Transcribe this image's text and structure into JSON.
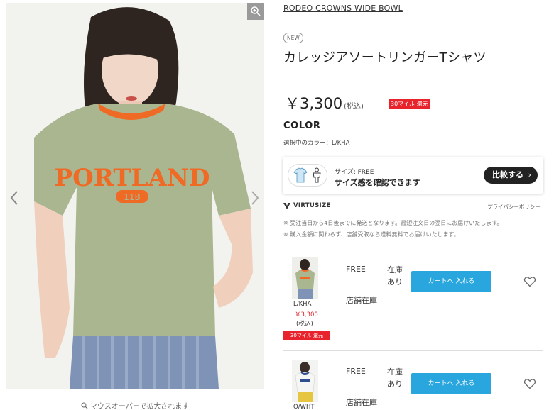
{
  "product": {
    "brand": "RODEO CROWNS WIDE BOWL",
    "badge": "NEW",
    "title": "カレッジアソートリンガーTシャツ",
    "price": "3,300",
    "currency_symbol": "￥",
    "tax_label": "(税込)",
    "miles_badge": "30マイル 還元"
  },
  "image": {
    "shirt_print_text": "PORTLAND",
    "shirt_print_number": "11B",
    "caption": "マウスオーバーで拡大されます"
  },
  "color": {
    "heading": "COLOR",
    "selected_label": "選択中のカラー：L/KHA"
  },
  "size_tool": {
    "size_label": "サイズ: FREE",
    "main_text": "サイズ感を確認できます",
    "compare_button": "比較する",
    "compare_chevron": "›"
  },
  "virtusize": {
    "logo_text": "VIRTUSIZE",
    "privacy_link": "プライバシーポリシー"
  },
  "notes": [
    "※ 受注当日から4日後までに発送となります。最短注文日の翌日にお届けいたします。",
    "※ 購入金額に関わらず、店舗受取なら送料無料でお届けいたします。"
  ],
  "skus": [
    {
      "code": "L/KHA",
      "price": "￥3,300",
      "tax": "(税込)",
      "miles": "30マイル 還元",
      "size": "FREE",
      "stock_line1": "在庫",
      "stock_line2": "あり",
      "store_link": "店舗在庫",
      "cart_button": "カートへ 入れる"
    },
    {
      "code": "O/WHT",
      "size": "FREE",
      "stock_line1": "在庫",
      "stock_line2": "あり",
      "store_link": "店舗在庫",
      "cart_button": "カートへ 入れる"
    }
  ],
  "colors": {
    "accent_red": "#e8232b",
    "cart_blue": "#2aa6de",
    "shirt_khaki": "#aab690",
    "print_orange": "#ef6a24"
  },
  "icons": [
    "zoom-icon",
    "chevron-left-icon",
    "chevron-right-icon",
    "magnifier-icon",
    "virtusize-logo-icon",
    "heart-icon"
  ]
}
